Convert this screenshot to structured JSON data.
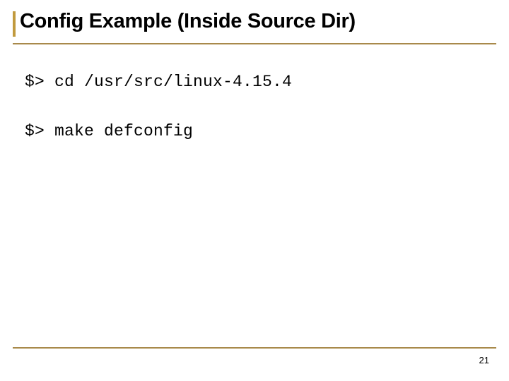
{
  "slide": {
    "title": "Config Example (Inside Source Dir)",
    "commands": {
      "cmd1": "$> cd /usr/src/linux-4.15.4",
      "cmd2": "$> make defconfig"
    },
    "page_number": "21"
  }
}
